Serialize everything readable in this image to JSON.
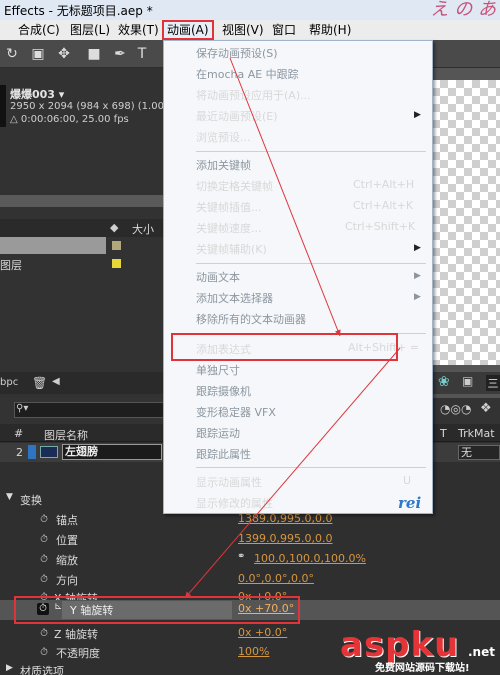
{
  "window": {
    "title": "Effects - 无标题项目.aep *"
  },
  "menubar": {
    "items": [
      "合成(C)",
      "图层(L)",
      "效果(T)",
      "动画(A)",
      "视图(V)",
      "窗口",
      "帮助(H)"
    ]
  },
  "project": {
    "comp_name": "爆爆003 ▾",
    "dimensions": "2950 x 2094  (984 x 698) (1.00)",
    "duration": "△ 0:00:06:00, 25.00 fps",
    "size_column": "大小",
    "row2_label": "图层",
    "bpc": "bpc"
  },
  "timeline": {
    "header_hash": "#",
    "header_name": "图层名称",
    "header_t": "T",
    "header_trkmat": "TrkMat",
    "layer_number": "2",
    "layer_name": "左翅膀",
    "trkmat_value": "无",
    "transform_label": "变换",
    "properties": [
      {
        "label": "锚点",
        "value": "1389.0,995.0,0.0"
      },
      {
        "label": "位置",
        "value": "1399.0,995.0,0.0"
      },
      {
        "label": "缩放",
        "value": "100.0,100.0,100.0%"
      },
      {
        "label": "方向",
        "value": "0.0°,0.0°,0.0°"
      },
      {
        "label": "X 轴旋转",
        "value": "0x +0.0°"
      },
      {
        "label": "Y 轴旋转",
        "value": "0x +70.0°"
      },
      {
        "label": "Z 轴旋转",
        "value": "0x +0.0°"
      },
      {
        "label": "不透明度",
        "value": "100%"
      }
    ],
    "material_label": "材质选项"
  },
  "animation_menu": {
    "items": [
      {
        "label": "保存动画预设(S)",
        "disabled": true
      },
      {
        "label": "在mocha AE 中跟踪",
        "disabled": true
      },
      {
        "label": "将动画预设应用于(A)...",
        "disabled": false
      },
      {
        "label": "最近动画预设(E)",
        "disabled": false,
        "submenu": true
      },
      {
        "label": "浏览预设...",
        "disabled": false
      },
      {
        "label": "添加关键帧",
        "disabled": true
      },
      {
        "label": "切换定格关键帧",
        "shortcut": "Ctrl+Alt+H",
        "disabled": false
      },
      {
        "label": "关键帧插值...",
        "shortcut": "Ctrl+Alt+K",
        "disabled": false
      },
      {
        "label": "关键帧速度...",
        "shortcut": "Ctrl+Shift+K",
        "disabled": false
      },
      {
        "label": "关键帧辅助(K)",
        "disabled": false,
        "submenu": true
      },
      {
        "label": "动画文本",
        "disabled": true,
        "submenu": true
      },
      {
        "label": "添加文本选择器",
        "disabled": true,
        "submenu": true
      },
      {
        "label": "移除所有的文本动画器",
        "disabled": true
      },
      {
        "label": "添加表达式",
        "shortcut": "Alt+Shift+ =",
        "disabled": false
      },
      {
        "label": "单独尺寸",
        "disabled": true
      },
      {
        "label": "跟踪摄像机",
        "disabled": true
      },
      {
        "label": "变形稳定器 VFX",
        "disabled": true
      },
      {
        "label": "跟踪运动",
        "disabled": true
      },
      {
        "label": "跟踪此属性",
        "disabled": true
      },
      {
        "label": "显示动画属性",
        "shortcut": "U",
        "disabled": false
      },
      {
        "label": "显示修改的属性",
        "disabled": false
      }
    ],
    "brand": "rei"
  },
  "viewer": {
    "tab_label": "三"
  },
  "watermark": {
    "main": "aspku",
    "suffix": ".net",
    "sub": "免费网站源码下载站!"
  },
  "colors": {
    "highlight_border": "#e0343a",
    "keyframe_value": "#d69640",
    "layer_color": "#2e76c4"
  }
}
